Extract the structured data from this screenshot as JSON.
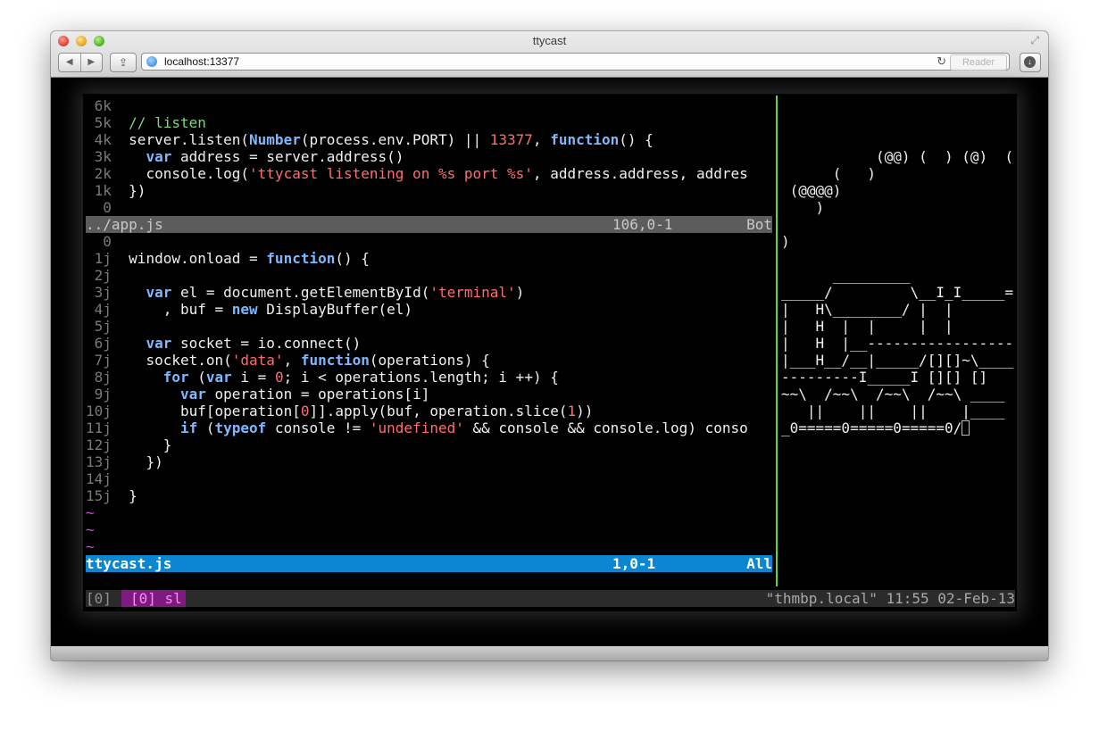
{
  "window": {
    "title": "ttycast",
    "url": "localhost:13377",
    "reader_label": "Reader",
    "nav_back": "◀",
    "nav_forward": "▶",
    "share_glyph": "⇪",
    "reload_glyph": "↻",
    "fullscreen_glyph": "⤢",
    "download_glyph": "↓"
  },
  "editor_top": {
    "lines": [
      {
        "n": " 6k",
        "segments": []
      },
      {
        "n": " 5k",
        "segments": [
          {
            "t": "// listen",
            "c": "cm"
          }
        ]
      },
      {
        "n": " 4k",
        "segments": [
          {
            "t": "server.listen(",
            "c": ""
          },
          {
            "t": "Number",
            "c": "kw"
          },
          {
            "t": "(process.env.PORT) || ",
            "c": ""
          },
          {
            "t": "13377",
            "c": "num"
          },
          {
            "t": ", ",
            "c": ""
          },
          {
            "t": "function",
            "c": "kw"
          },
          {
            "t": "() {",
            "c": ""
          }
        ]
      },
      {
        "n": " 3k",
        "segments": [
          {
            "t": "  ",
            "c": ""
          },
          {
            "t": "var",
            "c": "kw"
          },
          {
            "t": " address = server.address()",
            "c": ""
          }
        ]
      },
      {
        "n": " 2k",
        "segments": [
          {
            "t": "  console.log(",
            "c": ""
          },
          {
            "t": "'ttycast listening on %s port %s'",
            "c": "str"
          },
          {
            "t": ", address.address, addres",
            "c": ""
          }
        ]
      },
      {
        "n": " 1k",
        "segments": [
          {
            "t": "})",
            "c": ""
          }
        ]
      },
      {
        "n": " 0",
        "segments": []
      }
    ],
    "status": {
      "file": "../app.js",
      "pos": "106,0-1",
      "rel": "Bot"
    }
  },
  "editor_bottom": {
    "lines": [
      {
        "n": " 0",
        "segments": []
      },
      {
        "n": " 1j",
        "segments": [
          {
            "t": "window.onload = ",
            "c": ""
          },
          {
            "t": "function",
            "c": "kw"
          },
          {
            "t": "() {",
            "c": ""
          }
        ]
      },
      {
        "n": " 2j",
        "segments": []
      },
      {
        "n": " 3j",
        "segments": [
          {
            "t": "  ",
            "c": ""
          },
          {
            "t": "var",
            "c": "kw"
          },
          {
            "t": " el = document.getElementById(",
            "c": ""
          },
          {
            "t": "'terminal'",
            "c": "str"
          },
          {
            "t": ")",
            "c": ""
          }
        ]
      },
      {
        "n": " 4j",
        "segments": [
          {
            "t": "    , buf = ",
            "c": ""
          },
          {
            "t": "new",
            "c": "kw"
          },
          {
            "t": " DisplayBuffer(el)",
            "c": ""
          }
        ]
      },
      {
        "n": " 5j",
        "segments": []
      },
      {
        "n": " 6j",
        "segments": [
          {
            "t": "  ",
            "c": ""
          },
          {
            "t": "var",
            "c": "kw"
          },
          {
            "t": " socket = io.connect()",
            "c": ""
          }
        ]
      },
      {
        "n": " 7j",
        "segments": [
          {
            "t": "  socket.on(",
            "c": ""
          },
          {
            "t": "'data'",
            "c": "str"
          },
          {
            "t": ", ",
            "c": ""
          },
          {
            "t": "function",
            "c": "kw"
          },
          {
            "t": "(operations) {",
            "c": ""
          }
        ]
      },
      {
        "n": " 8j",
        "segments": [
          {
            "t": "    ",
            "c": ""
          },
          {
            "t": "for",
            "c": "kw"
          },
          {
            "t": " (",
            "c": ""
          },
          {
            "t": "var",
            "c": "kw"
          },
          {
            "t": " i = ",
            "c": ""
          },
          {
            "t": "0",
            "c": "num"
          },
          {
            "t": "; i < operations.length; i ++) {",
            "c": ""
          }
        ]
      },
      {
        "n": " 9j",
        "segments": [
          {
            "t": "      ",
            "c": ""
          },
          {
            "t": "var",
            "c": "kw"
          },
          {
            "t": " operation = operations[i]",
            "c": ""
          }
        ]
      },
      {
        "n": "10j",
        "segments": [
          {
            "t": "      buf[operation[",
            "c": ""
          },
          {
            "t": "0",
            "c": "num"
          },
          {
            "t": "]].apply(buf, operation.slice(",
            "c": ""
          },
          {
            "t": "1",
            "c": "num"
          },
          {
            "t": "))",
            "c": ""
          }
        ]
      },
      {
        "n": "11j",
        "segments": [
          {
            "t": "      ",
            "c": ""
          },
          {
            "t": "if",
            "c": "kw"
          },
          {
            "t": " (",
            "c": ""
          },
          {
            "t": "typeof",
            "c": "kw"
          },
          {
            "t": " console != ",
            "c": ""
          },
          {
            "t": "'undefined'",
            "c": "str"
          },
          {
            "t": " && console && console.log) conso",
            "c": ""
          }
        ]
      },
      {
        "n": "12j",
        "segments": [
          {
            "t": "    }",
            "c": ""
          }
        ]
      },
      {
        "n": "13j",
        "segments": [
          {
            "t": "  })",
            "c": ""
          }
        ]
      },
      {
        "n": "14j",
        "segments": []
      },
      {
        "n": "15j",
        "segments": [
          {
            "t": "}",
            "c": ""
          }
        ]
      }
    ],
    "tildes": [
      "~",
      "~",
      "~"
    ],
    "status": {
      "file": "ttycast.js",
      "pos": "1,0-1",
      "rel": "All"
    }
  },
  "sl_pane": {
    "lines": [
      "",
      "",
      "           (@@) (  ) (@)  ( ",
      "      (   )",
      " (@@@@)",
      "    )",
      "",
      ")",
      "",
      "      _________",
      "_____/         \\__I_I_____=",
      "|   H\\________/ |  |",
      "|   H  |  |     |  |",
      "|   H  |__-----------------",
      "|___H__/__|_____/[][]~\\____",
      "---------I_____I [][] []",
      "~~\\  /~~\\  /~~\\  /~~\\ ____",
      "   ||    ||    ||    |____",
      "_0=====0=====0=====0/"
    ]
  },
  "tmux": {
    "session": "[0]",
    "window": "[0] sl",
    "right": "\"thmbp.local\" 11:55 02-Feb-13"
  }
}
